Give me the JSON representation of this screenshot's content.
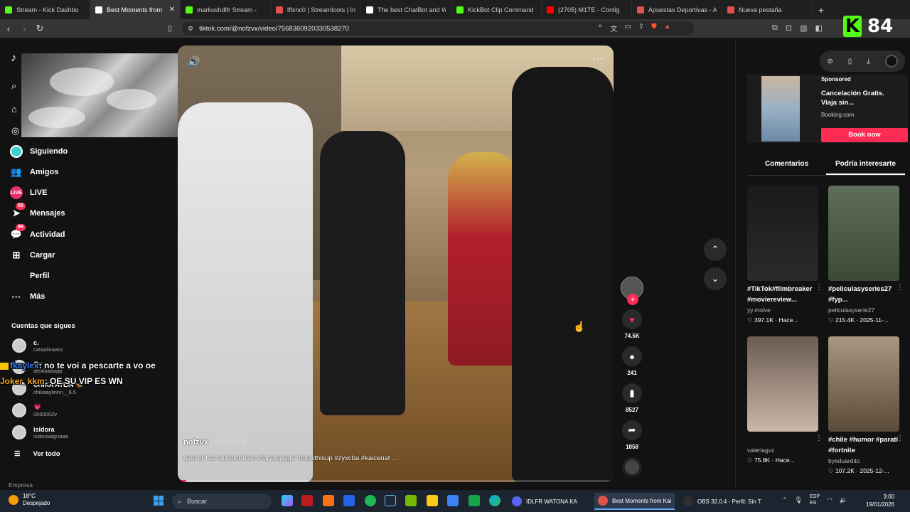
{
  "tabs": [
    {
      "title": "Stream - Kick Dashbo",
      "color": "#53fc18",
      "active": false
    },
    {
      "title": "Best Moments from",
      "color": "#ffffff",
      "active": true
    },
    {
      "title": "markushdlfr Stream -",
      "color": "#53fc18",
      "active": false
    },
    {
      "title": "lffxnc0 | Streamloots | Inte",
      "color": "#e0524f",
      "active": false
    },
    {
      "title": "The best ChatBot and Wid",
      "color": "#ffffff",
      "active": false
    },
    {
      "title": "KickBot Clip Command",
      "color": "#53fc18",
      "active": false
    },
    {
      "title": "(2705) M1TE - Contig",
      "color": "#ff0000",
      "active": false
    },
    {
      "title": "Apuestas Deportivas - Ap",
      "color": "#e0524f",
      "active": false
    },
    {
      "title": "Nueva pestaña",
      "color": "#e0524f",
      "active": false
    }
  ],
  "tab_close": "✕",
  "new_tab": "+",
  "address": {
    "url": "tiktok.com/@nofzvx/video/7568360920330538270"
  },
  "kick": {
    "letter": "K",
    "count": "84"
  },
  "sidebar": {
    "items": [
      {
        "label": "Siguiendo",
        "icon": "following-icon",
        "glyph": "",
        "badge": ""
      },
      {
        "label": "Amigos",
        "icon": "friends-icon",
        "glyph": "👥",
        "badge": ""
      },
      {
        "label": "LIVE",
        "icon": "live-icon",
        "glyph": "LIVE",
        "badge": ""
      },
      {
        "label": "Mensajes",
        "icon": "messages-icon",
        "glyph": "➤",
        "badge": "58"
      },
      {
        "label": "Actividad",
        "icon": "activity-icon",
        "glyph": "💬",
        "badge": "99"
      },
      {
        "label": "Cargar",
        "icon": "upload-icon",
        "glyph": "⊞",
        "badge": ""
      },
      {
        "label": "Perfil",
        "icon": "profile-icon",
        "glyph": "",
        "badge": ""
      },
      {
        "label": "Más",
        "icon": "more-icon",
        "glyph": "···",
        "badge": ""
      }
    ],
    "following_heading": "Cuentas que sigues",
    "accounts": [
      {
        "name": "c.",
        "handle": "cataalinaass"
      },
      {
        "name": "Gv",
        "handle": "alexlaaaapp"
      },
      {
        "name": "CHIKA AYLIN 🦋",
        "handle": "chikaaylinnn__6.5"
      },
      {
        "name": "💗",
        "handle": "0000002v"
      },
      {
        "name": "isidora",
        "handle": "isidoraaignaaa"
      }
    ],
    "see_all": "Ver todo",
    "company": "Empresa"
  },
  "chat": [
    {
      "user": "fkaylex",
      "message": ": no te voi a pescarte a vo oe"
    },
    {
      "user": "Joker_kkm",
      "message": ": OE SU VIP ES WN"
    }
  ],
  "video": {
    "author": "nofzvx",
    "date": " · 2025-11-3",
    "description": "best of Kai collaboration #foryoupage #blowthisup #zyxcba #kaicenat ...",
    "translate": "Ver traducción",
    "progress": 0.02
  },
  "actions": {
    "likes": "74.5K",
    "comments": "241",
    "saves": "8527",
    "shares": "1858"
  },
  "ad": {
    "sponsored": "Sponsored",
    "title": "Cancelación Gratis. Viaja sin...",
    "brand": "Booking.com",
    "button": "Book now"
  },
  "right_tabs": [
    {
      "label": "Comentarios",
      "active": false
    },
    {
      "label": "Podría interesarte",
      "active": true
    }
  ],
  "cards": [
    {
      "title": "#TikTok#filmbreaker #moviereview...",
      "user": "yy.moive",
      "stats": "♡ 397.1K · Hace..."
    },
    {
      "title": "#peliculasyseries27 #fyp...",
      "user": "peliculasyserie27",
      "stats": "♡ 215.4K · 2025-11-..."
    },
    {
      "title": "",
      "user": "valeriagvz",
      "stats": "♡ 75.8K · Hace..."
    },
    {
      "title": "#chile #humor #parati #fortnite",
      "user": "byeduardito",
      "stats": "♡ 107.2K · 2025-12-..."
    }
  ],
  "taskbar": {
    "temp": "18°C",
    "weather": "Despejado",
    "search": "Buscar",
    "windows": [
      {
        "label": "IDLFR WATONA KA",
        "active": false
      },
      {
        "label": "Best Moments from Kai",
        "active": true
      },
      {
        "label": "OBS 32.0.4 - Perfil: Sin T",
        "active": false
      }
    ],
    "lang1": "ESP",
    "lang2": "ES",
    "time": "3:00",
    "date": "19/01/2026"
  }
}
